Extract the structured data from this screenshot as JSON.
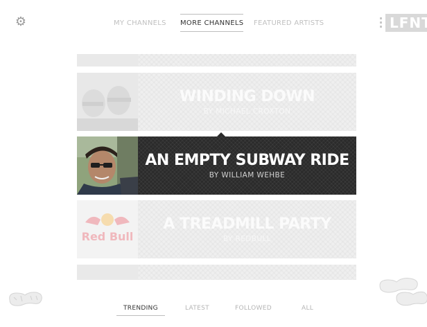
{
  "settings": {
    "icon": "gear-icon"
  },
  "top_tabs": [
    {
      "label": "MY CHANNELS",
      "active": false
    },
    {
      "label": "MORE CHANNELS",
      "active": true
    },
    {
      "label": "FEATURED ARTISTS",
      "active": false
    }
  ],
  "logo": {
    "text": "LFNT"
  },
  "channels": [
    {
      "title": "WINDING DOWN",
      "by": "BY MICHAEL CROXTON",
      "thumb": "two-men-selfie-photo",
      "active": false
    },
    {
      "title": "AN EMPTY SUBWAY RIDE",
      "by": "BY WILLIAM WEHBE",
      "thumb": "man-with-sunglasses-photo",
      "active": true
    },
    {
      "title": "A TREADMILL PARTY",
      "by": "BY REDBULL",
      "thumb": "Red Bull",
      "active": false
    }
  ],
  "bottom_tabs": [
    {
      "label": "TRENDING",
      "active": true
    },
    {
      "label": "LATEST",
      "active": false
    },
    {
      "label": "FOLLOWED",
      "active": false
    },
    {
      "label": "ALL",
      "active": false
    }
  ],
  "colors": {
    "active_card": "#2b2b2b",
    "inactive_card": "#efefef",
    "inactive_tab": "#c0c0c0"
  }
}
